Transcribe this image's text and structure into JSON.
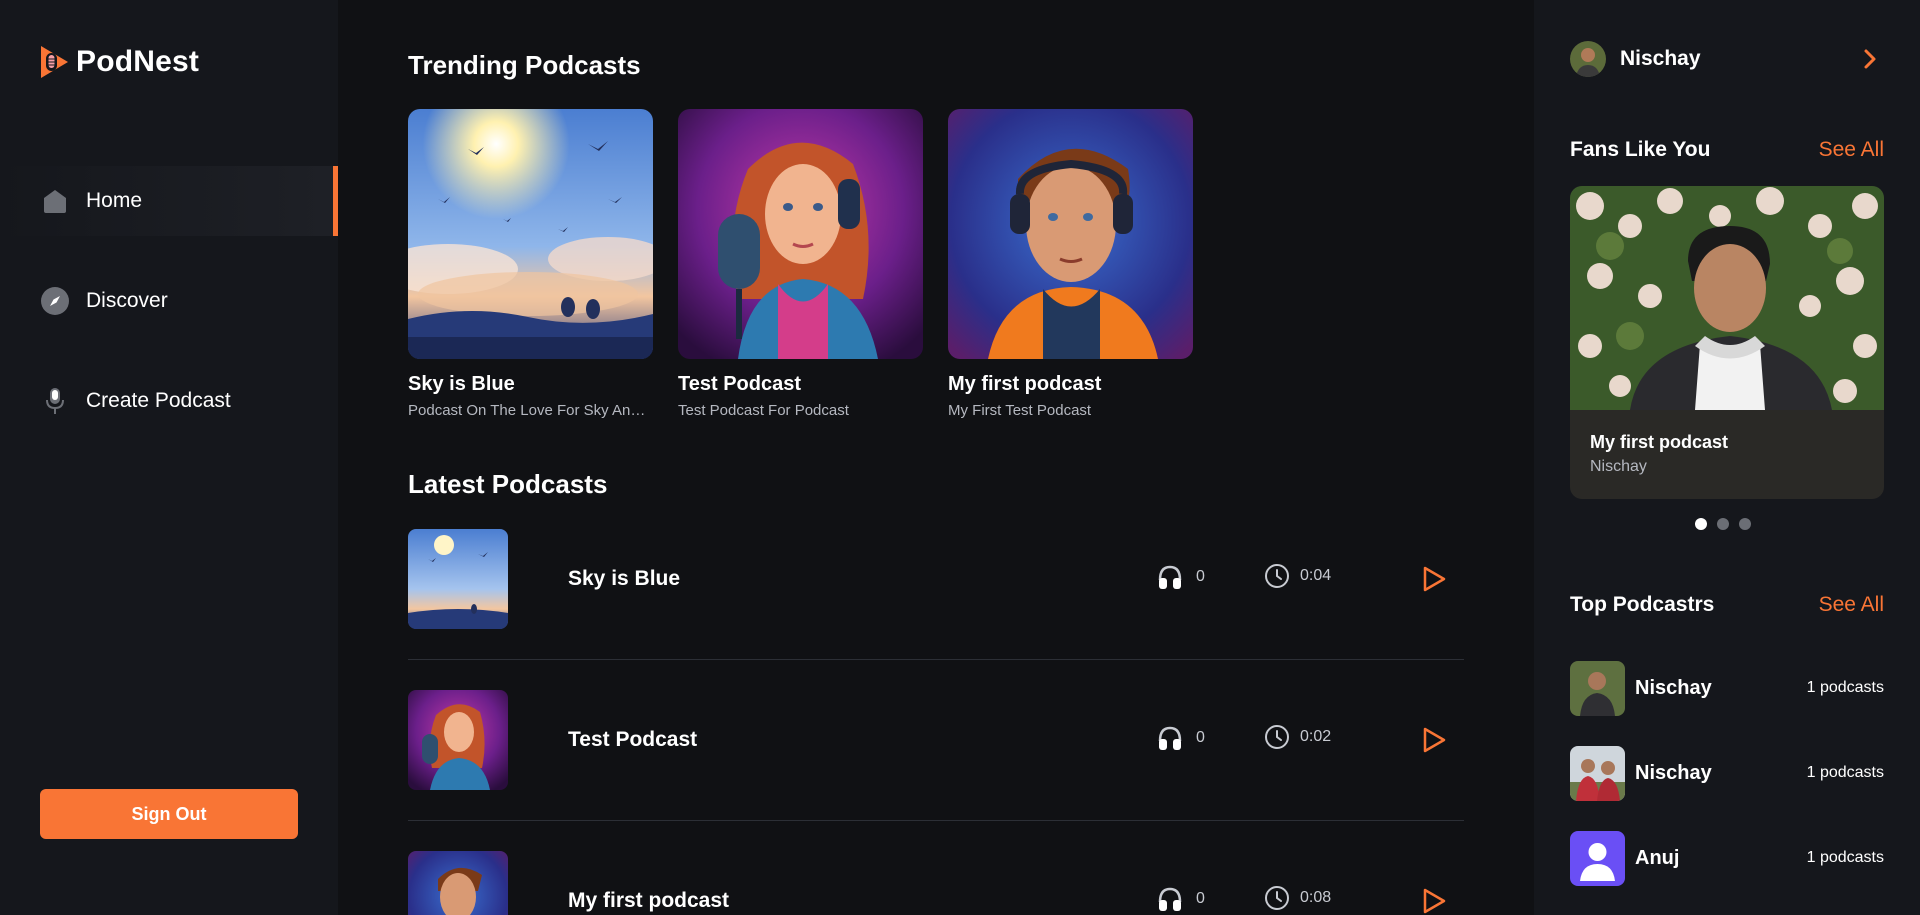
{
  "app": {
    "name": "PodNest",
    "accent": "#f97535"
  },
  "sidebar": {
    "items": [
      {
        "label": "Home",
        "icon": "home-icon",
        "active": true
      },
      {
        "label": "Discover",
        "icon": "compass-icon",
        "active": false
      },
      {
        "label": "Create Podcast",
        "icon": "microphone-icon",
        "active": false
      }
    ],
    "sign_out_label": "Sign Out"
  },
  "main": {
    "trending_title": "Trending Podcasts",
    "trending": [
      {
        "title": "Sky is Blue",
        "description": "Podcast On The Love For Sky And I...",
        "image": "sky-birds-artwork"
      },
      {
        "title": "Test Podcast",
        "description": "Test Podcast For Podcast",
        "image": "woman-microphone-artwork"
      },
      {
        "title": "My first podcast",
        "description": "My First Test Podcast",
        "image": "man-headphones-artwork"
      }
    ],
    "latest_title": "Latest Podcasts",
    "latest": [
      {
        "title": "Sky is Blue",
        "listens": "0",
        "duration": "0:04"
      },
      {
        "title": "Test Podcast",
        "listens": "0",
        "duration": "0:02"
      },
      {
        "title": "My first podcast",
        "listens": "0",
        "duration": "0:08"
      }
    ]
  },
  "rightbar": {
    "user_name": "Nischay",
    "fans_title": "Fans Like You",
    "see_all": "See All",
    "fan_card": {
      "title": "My first podcast",
      "author": "Nischay"
    },
    "carousel_active_index": 0,
    "top_title": "Top Podcastrs",
    "top_see_all": "See All",
    "top": [
      {
        "name": "Nischay",
        "count": "1 podcasts"
      },
      {
        "name": "Nischay",
        "count": "1 podcasts"
      },
      {
        "name": "Anuj",
        "count": "1 podcasts"
      }
    ]
  }
}
